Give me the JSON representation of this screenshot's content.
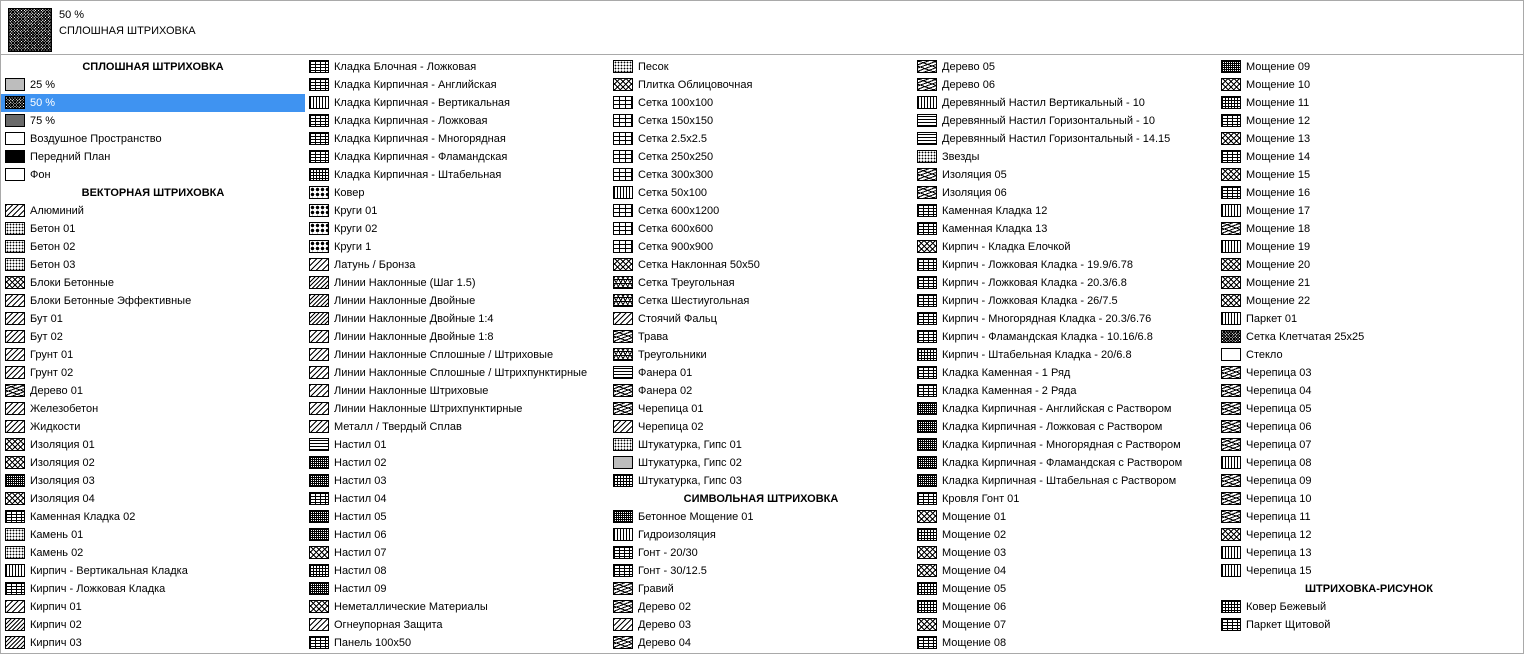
{
  "preview": {
    "percent": "50 %",
    "name": "СПЛОШНАЯ ШТРИХОВКА"
  },
  "columns": [
    [
      {
        "h": "СПЛОШНАЯ ШТРИХОВКА"
      },
      {
        "t": "25 %",
        "p": "solid25"
      },
      {
        "t": "50 %",
        "p": "solid50",
        "sel": true
      },
      {
        "t": "75 %",
        "p": "solid75"
      },
      {
        "t": "Воздушное Пространство",
        "p": "white"
      },
      {
        "t": "Передний План",
        "p": "black"
      },
      {
        "t": "Фон",
        "p": "white"
      },
      {
        "h": "ВЕКТОРНАЯ ШТРИХОВКА"
      },
      {
        "t": "Алюминий",
        "p": "diag"
      },
      {
        "t": "Бетон 01",
        "p": "dots"
      },
      {
        "t": "Бетон 02",
        "p": "dots"
      },
      {
        "t": "Бетон 03",
        "p": "dots"
      },
      {
        "t": "Блоки Бетонные",
        "p": "cross"
      },
      {
        "t": "Блоки Бетонные Эффективные",
        "p": "diag"
      },
      {
        "t": "Бут 01",
        "p": "diag"
      },
      {
        "t": "Бут 02",
        "p": "diag"
      },
      {
        "t": "Грунт 01",
        "p": "diag"
      },
      {
        "t": "Грунт 02",
        "p": "diag"
      },
      {
        "t": "Дерево 01",
        "p": "wave"
      },
      {
        "t": "Железобетон",
        "p": "diag"
      },
      {
        "t": "Жидкости",
        "p": "diag"
      },
      {
        "t": "Изоляция 01",
        "p": "cross"
      },
      {
        "t": "Изоляция 02",
        "p": "cross"
      },
      {
        "t": "Изоляция 03",
        "p": "dense"
      },
      {
        "t": "Изоляция 04",
        "p": "cross"
      },
      {
        "t": "Каменная Кладка 02",
        "p": "brick"
      },
      {
        "t": "Камень 01",
        "p": "dots"
      },
      {
        "t": "Камень 02",
        "p": "dots"
      },
      {
        "t": "Кирпич - Вертикальная Кладка",
        "p": "vlines"
      },
      {
        "t": "Кирпич - Ложковая Кладка",
        "p": "brick"
      },
      {
        "t": "Кирпич 01",
        "p": "diag"
      },
      {
        "t": "Кирпич 02",
        "p": "diag2"
      },
      {
        "t": "Кирпич 03",
        "p": "diag2"
      }
    ],
    [
      {
        "t": "Кладка Блочная - Ложковая",
        "p": "brick"
      },
      {
        "t": "Кладка Кирпичная - Английская",
        "p": "brick"
      },
      {
        "t": "Кладка Кирпичная - Вертикальная",
        "p": "vlines"
      },
      {
        "t": "Кладка Кирпичная - Ложковая",
        "p": "brick"
      },
      {
        "t": "Кладка Кирпичная - Многорядная",
        "p": "brick"
      },
      {
        "t": "Кладка Кирпичная - Фламандская",
        "p": "brick"
      },
      {
        "t": "Кладка Кирпичная - Штабельная",
        "p": "gridS"
      },
      {
        "t": "Ковер",
        "p": "dotsB"
      },
      {
        "t": "Круги 01",
        "p": "dotsB"
      },
      {
        "t": "Круги 02",
        "p": "dotsB"
      },
      {
        "t": "Круги 1",
        "p": "dotsB"
      },
      {
        "t": "Латунь / Бронза",
        "p": "diag"
      },
      {
        "t": "Линии Наклонные (Шаг 1.5)",
        "p": "diag2"
      },
      {
        "t": "Линии Наклонные Двойные",
        "p": "diag2"
      },
      {
        "t": "Линии Наклонные Двойные 1:4",
        "p": "diag2"
      },
      {
        "t": "Линии Наклонные Двойные 1:8",
        "p": "diag"
      },
      {
        "t": "Линии Наклонные Сплошные / Штриховые",
        "p": "diag"
      },
      {
        "t": "Линии Наклонные Сплошные / Штрихпунктирные",
        "p": "diag"
      },
      {
        "t": "Линии Наклонные Штриховые",
        "p": "diag"
      },
      {
        "t": "Линии Наклонные Штрихпунктирные",
        "p": "diag"
      },
      {
        "t": "Металл / Твердый Сплав",
        "p": "diag"
      },
      {
        "t": "Настил 01",
        "p": "hlines"
      },
      {
        "t": "Настил 02",
        "p": "dense"
      },
      {
        "t": "Настил 03",
        "p": "dense"
      },
      {
        "t": "Настил 04",
        "p": "brick"
      },
      {
        "t": "Настил 05",
        "p": "dense"
      },
      {
        "t": "Настил 06",
        "p": "dense"
      },
      {
        "t": "Настил 07",
        "p": "cross"
      },
      {
        "t": "Настил 08",
        "p": "gridS"
      },
      {
        "t": "Настил 09",
        "p": "dense"
      },
      {
        "t": "Неметаллические Материалы",
        "p": "cross"
      },
      {
        "t": "Огнеупорная Защита",
        "p": "diag"
      },
      {
        "t": "Панель 100x50",
        "p": "brick"
      }
    ],
    [
      {
        "t": "Песок",
        "p": "dots"
      },
      {
        "t": "Плитка Облицовочная",
        "p": "cross"
      },
      {
        "t": "Сетка 100x100",
        "p": "grid"
      },
      {
        "t": "Сетка 150x150",
        "p": "grid"
      },
      {
        "t": "Сетка 2.5x2.5",
        "p": "grid"
      },
      {
        "t": "Сетка 250x250",
        "p": "grid"
      },
      {
        "t": "Сетка 300x300",
        "p": "grid"
      },
      {
        "t": "Сетка 50x100",
        "p": "vlines"
      },
      {
        "t": "Сетка 600x1200",
        "p": "grid"
      },
      {
        "t": "Сетка 600x600",
        "p": "grid"
      },
      {
        "t": "Сетка 900x900",
        "p": "grid"
      },
      {
        "t": "Сетка Наклонная 50x50",
        "p": "cross"
      },
      {
        "t": "Сетка Треугольная",
        "p": "tri"
      },
      {
        "t": "Сетка Шестиугольная",
        "p": "tri"
      },
      {
        "t": "Стоячий Фальц",
        "p": "diag"
      },
      {
        "t": "Трава",
        "p": "wave"
      },
      {
        "t": "Треугольники",
        "p": "tri"
      },
      {
        "t": "Фанера 01",
        "p": "hlines"
      },
      {
        "t": "Фанера 02",
        "p": "wave"
      },
      {
        "t": "Черепица 01",
        "p": "wave"
      },
      {
        "t": "Черепица 02",
        "p": "diag"
      },
      {
        "t": "Штукатурка, Гипс 01",
        "p": "dots"
      },
      {
        "t": "Штукатурка, Гипс 02",
        "p": "solid25"
      },
      {
        "t": "Штукатурка, Гипс 03",
        "p": "gridS"
      },
      {
        "h": "СИМВОЛЬНАЯ ШТРИХОВКА"
      },
      {
        "t": "Бетонное Мощение 01",
        "p": "dense"
      },
      {
        "t": "Гидроизоляция",
        "p": "vlines"
      },
      {
        "t": "Гонт - 20/30",
        "p": "brick"
      },
      {
        "t": "Гонт - 30/12.5",
        "p": "brick"
      },
      {
        "t": "Гравий",
        "p": "wave"
      },
      {
        "t": "Дерево 02",
        "p": "wave"
      },
      {
        "t": "Дерево 03",
        "p": "diag"
      },
      {
        "t": "Дерево 04",
        "p": "wave"
      }
    ],
    [
      {
        "t": "Дерево 05",
        "p": "wave"
      },
      {
        "t": "Дерево 06",
        "p": "wave"
      },
      {
        "t": "Деревянный Настил Вертикальный - 10",
        "p": "vlines"
      },
      {
        "t": "Деревянный Настил Горизонтальный - 10",
        "p": "hlines"
      },
      {
        "t": "Деревянный Настил Горизонтальный - 14.15",
        "p": "hlines"
      },
      {
        "t": "Звезды",
        "p": "dots"
      },
      {
        "t": "Изоляция 05",
        "p": "wave"
      },
      {
        "t": "Изоляция 06",
        "p": "wave"
      },
      {
        "t": "Каменная Кладка 12",
        "p": "brick"
      },
      {
        "t": "Каменная Кладка 13",
        "p": "brick"
      },
      {
        "t": "Кирпич - Кладка Елочкой",
        "p": "cross"
      },
      {
        "t": "Кирпич - Ложковая Кладка - 19.9/6.78",
        "p": "brick"
      },
      {
        "t": "Кирпич - Ложковая Кладка - 20.3/6.8",
        "p": "brick"
      },
      {
        "t": "Кирпич - Ложковая Кладка - 26/7.5",
        "p": "brick"
      },
      {
        "t": "Кирпич - Многорядная Кладка - 20.3/6.76",
        "p": "brick"
      },
      {
        "t": "Кирпич - Фламандская Кладка - 10.16/6.8",
        "p": "brick"
      },
      {
        "t": "Кирпич - Штабельная Кладка - 20/6.8",
        "p": "gridS"
      },
      {
        "t": "Кладка Каменная - 1 Ряд",
        "p": "brick"
      },
      {
        "t": "Кладка Каменная - 2 Ряда",
        "p": "brick"
      },
      {
        "t": "Кладка Кирпичная - Английская с Раствором",
        "p": "dense"
      },
      {
        "t": "Кладка Кирпичная - Ложковая с Раствором",
        "p": "dense"
      },
      {
        "t": "Кладка Кирпичная - Многорядная с Раствором",
        "p": "dense"
      },
      {
        "t": "Кладка Кирпичная - Фламандская с Раствором",
        "p": "dense"
      },
      {
        "t": "Кладка Кирпичная - Штабельная с Раствором",
        "p": "dense"
      },
      {
        "t": "Кровля Гонт 01",
        "p": "brick"
      },
      {
        "t": "Мощение 01",
        "p": "cross"
      },
      {
        "t": "Мощение 02",
        "p": "gridS"
      },
      {
        "t": "Мощение 03",
        "p": "cross"
      },
      {
        "t": "Мощение 04",
        "p": "cross"
      },
      {
        "t": "Мощение 05",
        "p": "gridS"
      },
      {
        "t": "Мощение 06",
        "p": "gridS"
      },
      {
        "t": "Мощение 07",
        "p": "cross"
      },
      {
        "t": "Мощение 08",
        "p": "brick"
      }
    ],
    [
      {
        "t": "Мощение 09",
        "p": "dense"
      },
      {
        "t": "Мощение 10",
        "p": "cross"
      },
      {
        "t": "Мощение 11",
        "p": "gridS"
      },
      {
        "t": "Мощение 12",
        "p": "brick"
      },
      {
        "t": "Мощение 13",
        "p": "cross"
      },
      {
        "t": "Мощение 14",
        "p": "brick"
      },
      {
        "t": "Мощение 15",
        "p": "cross"
      },
      {
        "t": "Мощение 16",
        "p": "brick"
      },
      {
        "t": "Мощение 17",
        "p": "vlines"
      },
      {
        "t": "Мощение 18",
        "p": "wave"
      },
      {
        "t": "Мощение 19",
        "p": "vlines"
      },
      {
        "t": "Мощение 20",
        "p": "cross"
      },
      {
        "t": "Мощение 21",
        "p": "cross"
      },
      {
        "t": "Мощение 22",
        "p": "cross"
      },
      {
        "t": "Паркет 01",
        "p": "vlines"
      },
      {
        "t": "Сетка Клетчатая 25x25",
        "p": "solid50"
      },
      {
        "t": "Стекло",
        "p": "white"
      },
      {
        "t": "Черепица 03",
        "p": "wave"
      },
      {
        "t": "Черепица 04",
        "p": "wave"
      },
      {
        "t": "Черепица 05",
        "p": "wave"
      },
      {
        "t": "Черепица 06",
        "p": "wave"
      },
      {
        "t": "Черепица 07",
        "p": "wave"
      },
      {
        "t": "Черепица 08",
        "p": "vlines"
      },
      {
        "t": "Черепица 09",
        "p": "wave"
      },
      {
        "t": "Черепица 10",
        "p": "wave"
      },
      {
        "t": "Черепица 11",
        "p": "wave"
      },
      {
        "t": "Черепица 12",
        "p": "cross"
      },
      {
        "t": "Черепица 13",
        "p": "vlines"
      },
      {
        "t": "Черепица 15",
        "p": "vlines"
      },
      {
        "h": "ШТРИХОВКА-РИСУНОК"
      },
      {
        "t": "Ковер Бежевый",
        "p": "gridS"
      },
      {
        "t": "Паркет Щитовой",
        "p": "brick"
      }
    ]
  ]
}
